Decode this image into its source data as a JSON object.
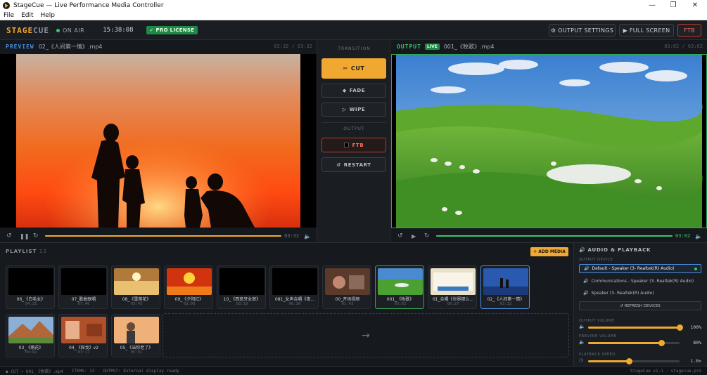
{
  "window": {
    "title": "StageCue — Live Performance Media Controller",
    "minimize": "—",
    "maximize": "❐",
    "close": "✕"
  },
  "menu": {
    "file": "File",
    "edit": "Edit",
    "help": "Help"
  },
  "header": {
    "logo_a": "STAGE",
    "logo_b": "CUE",
    "on_air": "ON AIR",
    "clock": "15:38:08",
    "license": "✓ PRO LICENSE",
    "output_settings": "⚙ OUTPUT SETTINGS",
    "full_screen": "▶ FULL SCREEN",
    "ftb": "FTB"
  },
  "preview": {
    "label": "PREVIEW",
    "file": "02_《人间第一情》.mp4",
    "timecode": "03:32 / 03:32",
    "time": "03:32",
    "progress": 1.0
  },
  "output": {
    "label": "OUTPUT",
    "live": "LIVE",
    "file": "001_《牧歌》.mp4",
    "timecode": "03:02 / 03:02",
    "time": "03:02",
    "progress": 1.0
  },
  "transition": {
    "section": "TRANSITION",
    "cut": "CUT",
    "fade": "FADE",
    "wipe": "WIPE",
    "output_section": "OUTPUT",
    "ftb": "FTB",
    "restart": "RESTART"
  },
  "playlist": {
    "label": "PLAYLIST",
    "count": "13",
    "add": "+ ADD MEDIA",
    "drop_arrow": "→",
    "items": [
      {
        "name": "06_《白毛女》",
        "dur": "04:31",
        "thumb": "black"
      },
      {
        "name": "07_歌曲联唱",
        "dur": "07:40",
        "thumb": "black"
      },
      {
        "name": "08_《雪莲花》",
        "dur": "03:45",
        "thumb": "gold"
      },
      {
        "name": "09_《夕阳红》",
        "dur": "03:08",
        "thumb": "red"
      },
      {
        "name": "10_《西班牙女郎》",
        "dur": "03:19",
        "thumb": "black"
      },
      {
        "name": "081_女声合唱《夜...",
        "dur": "06:30",
        "thumb": "black"
      },
      {
        "name": "00_开场视频",
        "dur": "01:43",
        "thumb": "brown"
      },
      {
        "name": "001_《牧歌》",
        "dur": "03:02",
        "thumb": "green",
        "state": "selected"
      },
      {
        "name": "01_合唱《世界那么...",
        "dur": "06:27",
        "thumb": "cream"
      },
      {
        "name": "02_《人间第一情》",
        "dur": "03:32",
        "thumb": "blue",
        "state": "active"
      },
      {
        "name": "03_《雨花》",
        "dur": "04:02",
        "thumb": "mountain"
      },
      {
        "name": "04_《探戈》v2",
        "dur": "03:17",
        "thumb": "rust"
      },
      {
        "name": "05_《当你老了》",
        "dur": "05:01",
        "thumb": "peach"
      }
    ]
  },
  "audio": {
    "title": "AUDIO & PLAYBACK",
    "device_label": "OUTPUT DEVICE",
    "devices": [
      "Default - Speaker (3- Realtek(R) Audio)",
      "Communications - Speaker (3- Realtek(R) Audio)",
      "Speaker (3- Realtek(R) Audio)"
    ],
    "refresh": "↺ REFRESH DEVICES",
    "output_volume_label": "OUTPUT VOLUME",
    "output_volume": "100%",
    "output_volume_level": 1.0,
    "preview_volume_label": "PREVIEW VOLUME",
    "preview_volume": "80%",
    "preview_volume_level": 0.8,
    "speed_label": "PLAYBACK SPEED",
    "speed": "1.0×",
    "speed_level": 0.45
  },
  "status": {
    "left": "● CUT → 001_《牧歌》.mp4",
    "items": "ITEMS: 13",
    "output": "OUTPUT: External display ready",
    "right": "StageCue v1.1 · stagecue.pro"
  },
  "colors": {
    "accent": "#f0a830",
    "live": "#2fa84f",
    "danger": "#c0392b",
    "selected_blue": "#4a8fe0"
  }
}
